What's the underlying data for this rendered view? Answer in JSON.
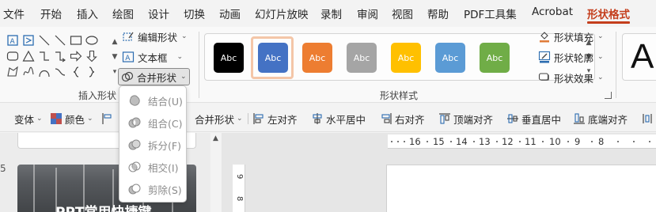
{
  "menubar": {
    "items": [
      "文件",
      "开始",
      "插入",
      "绘图",
      "设计",
      "切换",
      "动画",
      "幻灯片放映",
      "录制",
      "审阅",
      "视图",
      "帮助",
      "PDF工具集",
      "Acrobat",
      "形状格式"
    ],
    "active": "形状格式",
    "accent_color": "#c43e1c"
  },
  "insert_shapes": {
    "edit_shape": "编辑形状",
    "text_box": "文本框",
    "merge_shapes": "合并形状",
    "group_label": "插入形状"
  },
  "shape_styles": {
    "swatches": [
      {
        "label": "Abc",
        "color": "#000000"
      },
      {
        "label": "Abc",
        "color": "#4472c4"
      },
      {
        "label": "Abc",
        "color": "#ed7d31"
      },
      {
        "label": "Abc",
        "color": "#a5a5a5"
      },
      {
        "label": "Abc",
        "color": "#ffc000"
      },
      {
        "label": "Abc",
        "color": "#5b9bd5"
      },
      {
        "label": "Abc",
        "color": "#70ad47"
      }
    ],
    "selected_index": 1,
    "fill": "形状填充",
    "outline": "形状轮廓",
    "effects": "形状效果",
    "group_label": "形状样式"
  },
  "wordart": {
    "preview": "A"
  },
  "toolbar2": {
    "transform": "变体",
    "color": "颜色",
    "merge_shapes": "合并形状",
    "align_left": "左对齐",
    "align_center": "水平居中",
    "align_right": "右对齐",
    "align_top": "顶端对齐",
    "align_middle": "垂直居中",
    "align_bottom": "底端对齐"
  },
  "merge_menu": {
    "items": [
      "结合(U)",
      "组合(C)",
      "拆分(F)",
      "相交(I)",
      "剪除(S)"
    ]
  },
  "workspace": {
    "slide_number": "5",
    "slide_title": "PPT常用快捷键",
    "h_ruler": [
      "16",
      "15",
      "14",
      "13",
      "12",
      "11",
      "10",
      "9",
      "8"
    ],
    "v_ruler": [
      "9",
      "8"
    ]
  }
}
